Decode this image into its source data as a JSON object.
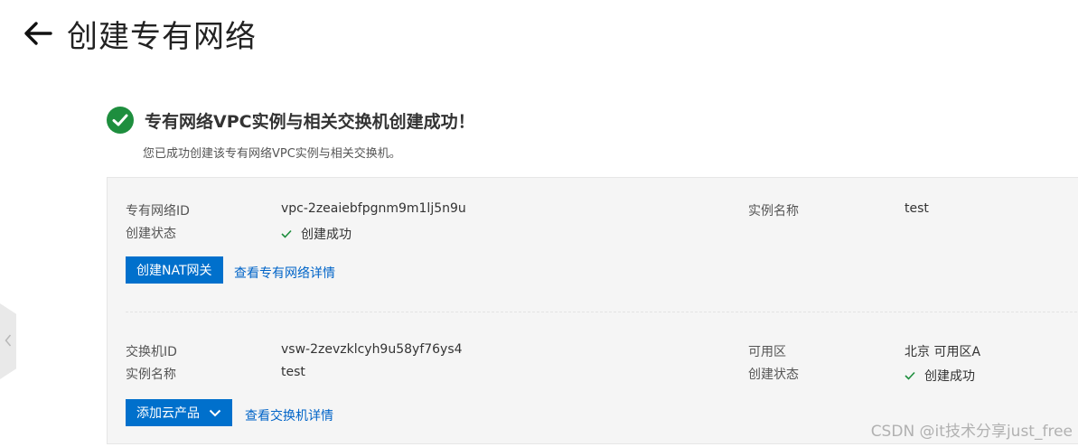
{
  "header": {
    "title": "创建专有网络",
    "back_icon": "arrow-left-icon"
  },
  "result": {
    "title": "专有网络VPC实例与相关交换机创建成功！",
    "subtitle": "您已成功创建该专有网络VPC实例与相关交换机。",
    "icon": "check-circle-icon",
    "accent": "#1e8e3e"
  },
  "vpc": {
    "id_label": "专有网络ID",
    "id_value": "vpc-2zeaiebfpgnm9m1lj5n9u",
    "status_label": "创建状态",
    "status_value": "创建成功",
    "name_label": "实例名称",
    "name_value": "test",
    "create_nat_button": "创建NAT网关",
    "details_link": "查看专有网络详情"
  },
  "vswitch": {
    "id_label": "交换机ID",
    "id_value": "vsw-2zevzklcyh9u58yf76ys4",
    "name_label": "实例名称",
    "name_value": "test",
    "zone_label": "可用区",
    "zone_value": "北京 可用区A",
    "status_label": "创建状态",
    "status_value": "创建成功",
    "add_product_button": "添加云产品",
    "details_link": "查看交换机详情"
  },
  "colors": {
    "primary": "#0070cc",
    "link": "#0064c8",
    "success": "#1e8e3e"
  },
  "watermark": "CSDN @it技术分享just_free"
}
